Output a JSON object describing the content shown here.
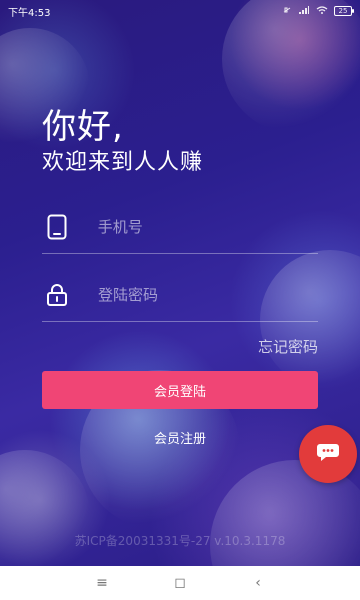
{
  "status_bar": {
    "time": "下午4:53",
    "battery": "25"
  },
  "greeting": {
    "line1": "你好,",
    "line2": "欢迎来到人人赚"
  },
  "phone_field": {
    "placeholder": "手机号"
  },
  "password_field": {
    "placeholder": "登陆密码"
  },
  "forgot_password": "忘记密码",
  "login_button": "会员登陆",
  "register_link": "会员注册",
  "footer_text": "苏ICP备20031331号-27 v.10.3.1178",
  "icons": {
    "phone": "phone-icon",
    "lock": "lock-icon",
    "chat": "chat-icon"
  },
  "colors": {
    "accent": "#f04575",
    "fab": "#e23b3b",
    "bg_primary": "#2b1f8f"
  },
  "nav": {
    "menu": "≡",
    "home": "◻",
    "back": "‹"
  }
}
